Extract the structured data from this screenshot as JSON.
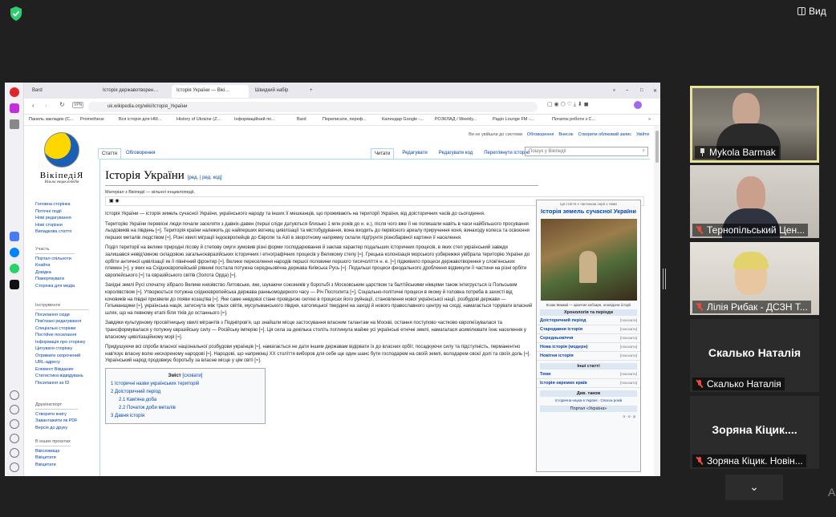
{
  "meeting": {
    "view_label": "Вид",
    "edge_char": "А",
    "participants": [
      {
        "name": "Mykola Barmak",
        "speaking": true,
        "muted": false,
        "pinned": true
      },
      {
        "name": "Тернопільський Цен...",
        "muted": true
      },
      {
        "name": "Лілія Рибак - ДСЗН Т...",
        "muted": true
      },
      {
        "name": "Скалько Наталія",
        "big_name": "Скалько Наталія",
        "muted": true
      },
      {
        "name": "Зоряна Кіцик. Новін...",
        "big_name": "Зоряна Кіцик....",
        "muted": true
      }
    ],
    "colors": {
      "speaking_border": "#e9e49a",
      "muted_icon": "#e74c3c",
      "shield": "#2ecc71"
    }
  },
  "browser": {
    "tabs": [
      {
        "label": "Bard"
      },
      {
        "label": "Історія державотворен…"
      },
      {
        "label": "Історія України — Вікі…",
        "active": true
      },
      {
        "label": "Швидкий набір"
      }
    ],
    "url": "uk.wikipedia.org/wiki/Історія_України",
    "url_badge": "VPN",
    "bookmarks": [
      "Панель закладок (С...",
      "Prometheus",
      "Вся історія для НМ...",
      "History of Ukraine (Z...",
      "Інформаційний по...",
      "Bard",
      "Переписати, переф...",
      "Календар Google -...",
      "РОЗКЛАД / Weekly...",
      "Радіо Lounge FM -...",
      "Початок роботи з C..."
    ]
  },
  "wiki": {
    "logo_name": "ВікіпедіЯ",
    "logo_tagline": "Вільна енциклопедія",
    "user_nav": [
      "Ви не увійшли до системи",
      "Обговорення",
      "Внесок",
      "Створити обліковий запис",
      "Увійти"
    ],
    "tabs_left": [
      "Стаття",
      "Обговорення"
    ],
    "tabs_right": [
      "Читати",
      "Редагувати",
      "Редагувати код",
      "Переглянути історію"
    ],
    "search_placeholder": "Пошук у Вікіпедії",
    "nav_main": [
      "Головна сторінка",
      "Поточні події",
      "Нові редагування",
      "Нові сторінки",
      "Випадкова стаття"
    ],
    "nav_participate_title": "Участь",
    "nav_participate": [
      "Портал спільноти",
      "Кнайпа",
      "Довідка",
      "Пожертвувати",
      "Сторінка для медіа"
    ],
    "nav_tools_title": "Інструменти",
    "nav_tools": [
      "Посилання сюди",
      "Пов'язані редагування",
      "Спеціальні сторінки",
      "Постійне посилання",
      "Інформація про сторінку",
      "Цитувати сторінку",
      "Отримати скорочений URL-адресу",
      "Елемент Вікіданих",
      "Статистика відвідувань",
      "Посилання за ID"
    ],
    "nav_print_title": "Друк/експорт",
    "nav_print": [
      "Створити книгу",
      "Завантажити як PDF",
      "Версія до друку"
    ],
    "nav_other_title": "В інших проєктах",
    "nav_other": [
      "Вікісховище",
      "Вікіцитати",
      "Вікіцитати"
    ],
    "title": "Історія України",
    "title_edit": "[ред. | ред. код]",
    "subtitle": "Матеріал з Вікіпедії — вільної енциклопедії.",
    "paragraphs": [
      "Історія України — історія земель сучасної України, українського народу та інших її мешканців, що проживають на території України, від доісторичних часів до сьогодення.",
      "Територію України перевісні люди почали заселяти з давніх-давен (перші сліди датуються близько 1 млн років до н. е.), після чого вже її не полишали навіть в часи найбільшого просування льодовиків на південь [≈]. Територія країни належить до найперших вогнищ цивілізації та містобудування, вона входить до первісного ареалу приручення коня, винаходу колеса та освоєння перших металів людством [≈]. Різні хвилі міграції індоєвропейців до Європи та Азії в зворотному напрямку склали підґрунтя різнобарвної картини її населення.",
      "Поділ території на велике природні лісову й степову смуги зумовив різні форми господарювання й заклав характер подальших історичних процесів, в яких степ український завжди залишався невід'ємною складовою загальноєвразійських історичних і етнографічних процесів у Великому степу [≈]. Грецька колонізація морського узбережжя увібрала територію України до орбіти античної цивілізації як її північний фронтир [≈]. Велике переселення народів першої половини першого тисячоліття н. е. [≈] підживило процеси державотворення у слов'янських племен [≈], у яких на Східноєвропейській рівнині постала потужна середньовічна держава Київська Русь [≈]. Подальші процеси феодального дроблення відвинули її частини на різні орбіти європейського [≈] та євразійського світів (Золота Орда) [≈].",
      "Західні землі Русі спочатку зібрало Велике князівство Литовське, яке, шукаючи союзників у боротьбі з Московським царством та балтійськими німцями також інтегрується із Польським королівством [≈]. Утворюється потужна східноєвропейська держава ранньомодерного часу — Річ Посполита [≈]. Соціально-політичні процеси в якому й головна потреба в захисті від кочовиків на півдні призвели до появи козацтва [≈]. Яке саме невдовзі стане провідною силою в процесах його руйнації, становлення нової української нації, розбудові держави — Гетьманщини [≈], українська нація, затиснута між трьох світів, мусульманського півдня, католицької твердині на заході й нового православного центру на сході, намагається торувати власний шлях, що на певному етапі біля тіхів до останнього [≈].",
      "Завдяки культурному просвітницьку хвилі мігрантів з Подніпров'я, що знайшли місце застосування власним талантам на Москві, остання поступово частково європеїзувалася та трансформувалася у потужну євразійську силу — Російську імперію [≈]. Ця сила за декілька століть поглинула майже усі українські етнічні землі, намагалася асимілювати їхнє населення у власному цивілізаційному морі [≈].",
      "Придушуючи всі спроби власної національної розбудови українців [≈], намагається не дати іншим державам відірвати їх до власних орбіт, посадкуючи силу та підступність, перманентно нав'язує власну волю нескореному народові [≈]. Народові, що наприкінці XX століття виборов для себе ще один шанс бути господарем на своїй землі, володарем своєї долі та своїх доль [≈]. Український народ продовжує боротьбу за власне місце у цім світі [≈]."
    ],
    "toc": {
      "title": "Зміст",
      "toggle": "[сховати]",
      "items": [
        "1  Історичні назви українських територій",
        "2  Доісторичний період",
        "2.1  Кам'яна доба",
        "2.2  Початок доби металів",
        "3  Давня історія"
      ]
    },
    "infobox": {
      "subtitle": "Ця стаття є частиною серії з теми",
      "title": "Історія земель сучасної України",
      "caption": "Козак Мамай — архетип кобзаря, оповідача історії",
      "section1": "Хронологія та періоди",
      "rows1": [
        "Доісторичний період",
        "Стародавня історія",
        "Середньовіччя",
        "Нова історія (модерн)",
        "Новітня історія"
      ],
      "section2": "Інші статті",
      "rows2": [
        "Теми",
        "Історія окремих країв"
      ],
      "section3": "Див. також",
      "see_also": "Історична наука в Україні · Список років",
      "portal": "Портал «Україна»",
      "show": "[показати]",
      "footer": "п · о · р"
    }
  }
}
